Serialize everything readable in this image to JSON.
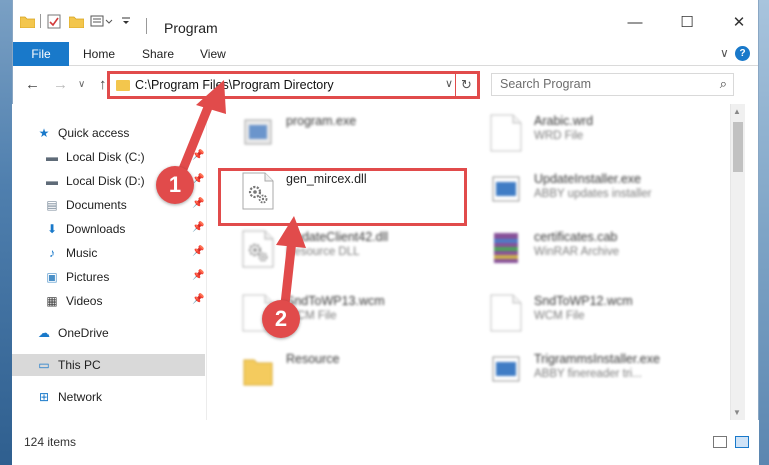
{
  "window": {
    "title": "Program",
    "minimize_glyph": "—",
    "maximize_glyph": "☐",
    "close_glyph": "✕"
  },
  "ribbon": {
    "tabs": [
      "File",
      "Home",
      "Share",
      "View"
    ],
    "expand_glyph": "∨",
    "help_glyph": "?"
  },
  "nav": {
    "back_glyph": "←",
    "forward_glyph": "→",
    "recent_glyph": "∨",
    "up_glyph": "↑"
  },
  "address": {
    "path": "C:\\Program Files\\Program Directory",
    "dropdown_glyph": "∨",
    "refresh_glyph": "↻"
  },
  "search": {
    "placeholder": "Search Program",
    "icon_glyph": "⌕"
  },
  "sidebar": {
    "pin_glyph": "📌",
    "items": [
      {
        "label": "Quick access",
        "icon": "star-icon",
        "glyph": "★",
        "color": "#1979ca",
        "pinned": false,
        "level": 0
      },
      {
        "label": "Local Disk (C:)",
        "icon": "drive-icon",
        "glyph": "▬",
        "color": "#5f6b78",
        "pinned": true,
        "level": 1
      },
      {
        "label": "Local Disk (D:)",
        "icon": "drive-icon",
        "glyph": "▬",
        "color": "#5f6b78",
        "pinned": true,
        "level": 1
      },
      {
        "label": "Documents",
        "icon": "documents-icon",
        "glyph": "▤",
        "color": "#7a8a9a",
        "pinned": true,
        "level": 1
      },
      {
        "label": "Downloads",
        "icon": "downloads-icon",
        "glyph": "⬇",
        "color": "#1979ca",
        "pinned": true,
        "level": 1
      },
      {
        "label": "Music",
        "icon": "music-icon",
        "glyph": "♪",
        "color": "#1979ca",
        "pinned": true,
        "level": 1
      },
      {
        "label": "Pictures",
        "icon": "pictures-icon",
        "glyph": "▣",
        "color": "#4a90c8",
        "pinned": true,
        "level": 1
      },
      {
        "label": "Videos",
        "icon": "videos-icon",
        "glyph": "▦",
        "color": "#444444",
        "pinned": true,
        "level": 1
      },
      {
        "label": "OneDrive",
        "icon": "onedrive-icon",
        "glyph": "☁",
        "color": "#1979ca",
        "pinned": false,
        "level": 0
      },
      {
        "label": "This PC",
        "icon": "this-pc-icon",
        "glyph": "▭",
        "color": "#1979ca",
        "pinned": false,
        "level": 0,
        "selected": true
      },
      {
        "label": "Network",
        "icon": "network-icon",
        "glyph": "⊞",
        "color": "#1979ca",
        "pinned": false,
        "level": 0
      }
    ]
  },
  "files": [
    {
      "name": "program.exe",
      "type": "",
      "icon": "exe-icon",
      "blurred": true
    },
    {
      "name": "Arabic.wrd",
      "type": "WRD File",
      "icon": "document-icon",
      "blurred": true
    },
    {
      "name": "gen_mircex.dll",
      "type": "",
      "icon": "dll-gear-icon",
      "blurred": false
    },
    {
      "name": "UpdateInstaller.exe",
      "type": "ABBY updates installer",
      "icon": "installer-icon",
      "blurred": true
    },
    {
      "name": "UpdateClient42.dll",
      "type": "Resource DLL",
      "icon": "dll-gear-icon",
      "blurred": true
    },
    {
      "name": "certificates.cab",
      "type": "WinRAR Archive",
      "icon": "winrar-icon",
      "blurred": true
    },
    {
      "name": "SndToWP13.wcm",
      "type": "WCM File",
      "icon": "document-icon",
      "blurred": true
    },
    {
      "name": "SndToWP12.wcm",
      "type": "WCM File",
      "icon": "document-icon",
      "blurred": true
    },
    {
      "name": "Resource",
      "type": "",
      "icon": "folder-icon",
      "blurred": true
    },
    {
      "name": "TrigrammsInstaller.exe",
      "type": "ABBY finereader tri...",
      "icon": "installer-icon",
      "blurred": true
    }
  ],
  "status": {
    "item_count": "124 items"
  },
  "annotations": {
    "step1": "1",
    "step2": "2",
    "color": "#e14b4b"
  },
  "colors": {
    "accent": "#1979ca",
    "highlight": "#e14b4b",
    "folder": "#f3c64d"
  }
}
